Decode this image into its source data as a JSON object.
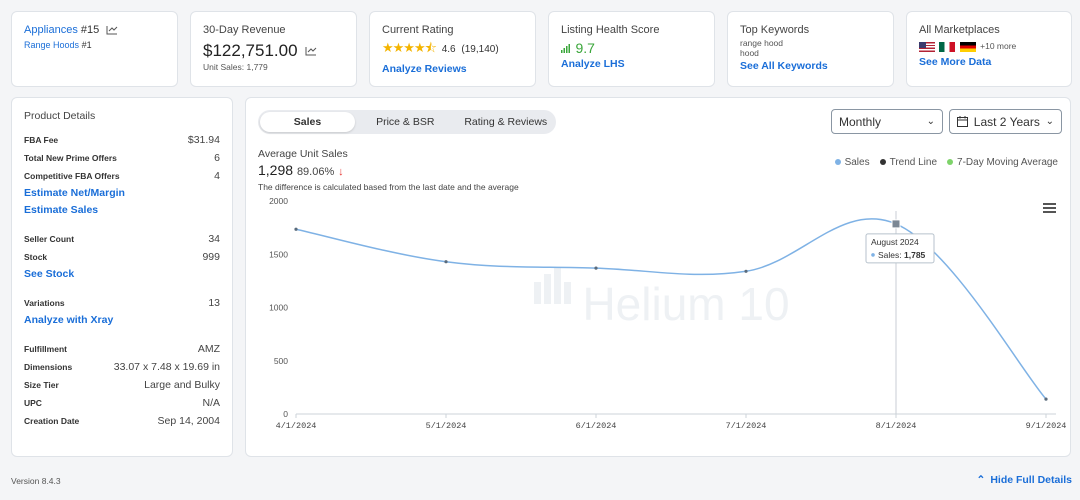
{
  "kpis": {
    "category": {
      "name": "Appliances",
      "rank": "#15",
      "sub": "Range Hoods",
      "sub_rank": "#1"
    },
    "revenue": {
      "title": "30-Day Revenue",
      "value": "$122,751.00",
      "units_label": "Unit Sales:",
      "units_value": "1,779"
    },
    "rating": {
      "title": "Current Rating",
      "score": "4.6",
      "count": "(19,140)",
      "link": "Analyze Reviews"
    },
    "health": {
      "title": "Listing Health Score",
      "score": "9.7",
      "link": "Analyze LHS"
    },
    "keywords": {
      "title": "Top Keywords",
      "k1": "range hood",
      "k2": "hood",
      "link": "See All Keywords"
    },
    "marketplaces": {
      "title": "All Marketplaces",
      "more": "+10 more",
      "link": "See More Data"
    }
  },
  "details": {
    "title": "Product Details",
    "fba_fee_label": "FBA Fee",
    "fba_fee": "$31.94",
    "prime_label": "Total New Prime Offers",
    "prime": "6",
    "comp_label": "Competitive FBA Offers",
    "comp": "4",
    "est_margin": "Estimate Net/Margin",
    "est_sales": "Estimate Sales",
    "seller_label": "Seller Count",
    "seller": "34",
    "stock_label": "Stock",
    "stock": "999",
    "see_stock": "See Stock",
    "variations_label": "Variations",
    "variations": "13",
    "xray": "Analyze with Xray",
    "fulfillment_label": "Fulfillment",
    "fulfillment": "AMZ",
    "dimensions_label": "Dimensions",
    "dimensions": "33.07 x 7.48 x 19.69 in",
    "size_label": "Size Tier",
    "size": "Large and Bulky",
    "upc_label": "UPC",
    "upc": "N/A",
    "created_label": "Creation Date",
    "created": "Sep 14, 2004"
  },
  "tabs": {
    "sales": "Sales",
    "price": "Price & BSR",
    "rating": "Rating & Reviews"
  },
  "filters": {
    "period": "Monthly",
    "range": "Last 2 Years"
  },
  "summary": {
    "label": "Average Unit Sales",
    "value": "1,298",
    "pct": "89.06%",
    "note": "The difference is calculated based from the last date and the average"
  },
  "legend": {
    "sales": "Sales",
    "trend": "Trend Line",
    "moving": "7-Day Moving Average"
  },
  "colors": {
    "sales": "#7fb2e5",
    "trend": "#333333",
    "moving": "#7ed36a",
    "accent": "#1a6ed8"
  },
  "watermark": "Helium 10",
  "tooltip": {
    "date": "August 2024",
    "label": "Sales:",
    "value": "1,785"
  },
  "chart_data": {
    "type": "line",
    "x": [
      "4/1/2024",
      "5/1/2024",
      "6/1/2024",
      "7/1/2024",
      "8/1/2024",
      "9/1/2024"
    ],
    "series": [
      {
        "name": "Sales",
        "values": [
          1735,
          1430,
          1370,
          1340,
          1785,
          140
        ]
      }
    ],
    "y_ticks": [
      0,
      500,
      1000,
      1500,
      2000
    ],
    "ylim": [
      0,
      2000
    ]
  },
  "footer": {
    "version": "Version 8.4.3",
    "hide": "Hide Full Details"
  }
}
